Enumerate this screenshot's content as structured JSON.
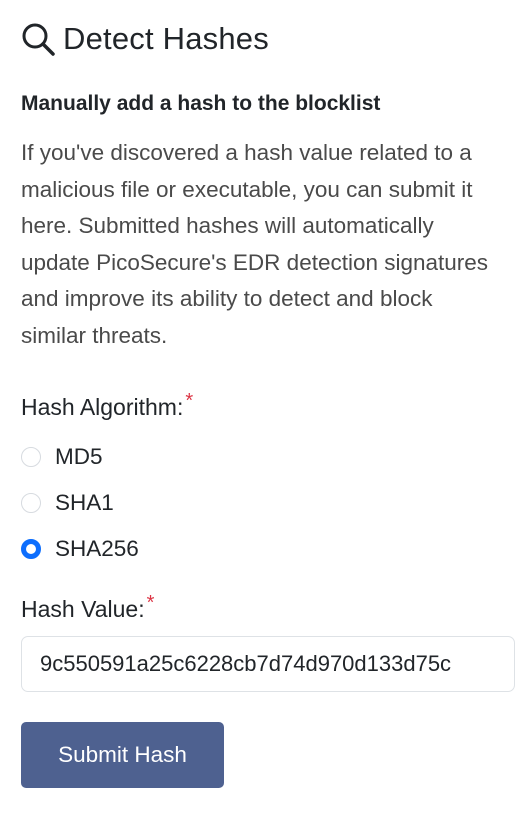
{
  "header": {
    "icon": "search-icon",
    "title": "Detect Hashes"
  },
  "section": {
    "subheading": "Manually add a hash to the blocklist",
    "description": "If you've discovered a hash value related to a malicious file or executable, you can submit it here. Submitted hashes will automatically update PicoSecure's EDR detection signatures and improve its ability to detect and block similar threats."
  },
  "form": {
    "algorithm_label": "Hash Algorithm:",
    "required_mark": "*",
    "algorithms": [
      {
        "label": "MD5",
        "checked": false
      },
      {
        "label": "SHA1",
        "checked": false
      },
      {
        "label": "SHA256",
        "checked": true
      }
    ],
    "value_label": "Hash Value:",
    "hash_value": "9c550591a25c6228cb7d74d970d133d75c",
    "submit_label": "Submit Hash"
  },
  "colors": {
    "accent": "#0d6efd",
    "button": "#4e6190",
    "required": "#dc3545"
  }
}
